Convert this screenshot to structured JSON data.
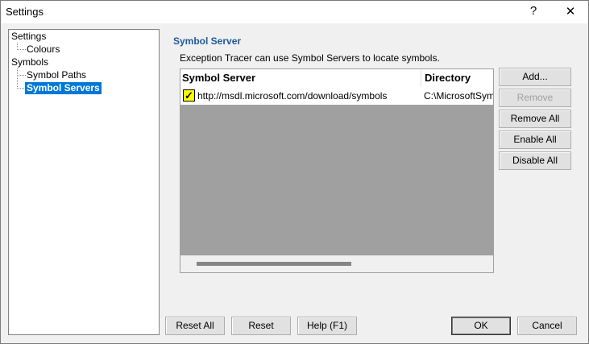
{
  "window": {
    "title": "Settings",
    "help_label": "?",
    "close_label": "✕"
  },
  "tree": {
    "items": [
      {
        "label": "Settings",
        "level": 0
      },
      {
        "label": "Colours",
        "level": 1
      },
      {
        "label": "Symbols",
        "level": 0
      },
      {
        "label": "Symbol Paths",
        "level": 1
      },
      {
        "label": "Symbol Servers",
        "level": 1,
        "selected": true
      }
    ]
  },
  "section": {
    "title": "Symbol Server",
    "description": "Exception Tracer can use Symbol Servers to locate symbols."
  },
  "list": {
    "columns": [
      "Symbol Server",
      "Directory"
    ],
    "rows": [
      {
        "checked": true,
        "server": "http://msdl.microsoft.com/download/symbols",
        "directory": "C:\\MicrosoftSym"
      }
    ]
  },
  "side_buttons": {
    "add": "Add...",
    "remove": "Remove",
    "remove_all": "Remove All",
    "enable_all": "Enable All",
    "disable_all": "Disable All"
  },
  "bottom_buttons": {
    "reset_all": "Reset All",
    "reset": "Reset",
    "help": "Help (F1)",
    "ok": "OK",
    "cancel": "Cancel"
  },
  "colors": {
    "accent": "#0078d7",
    "section_title": "#1c5a9c",
    "checkbox": "#ffff00"
  }
}
